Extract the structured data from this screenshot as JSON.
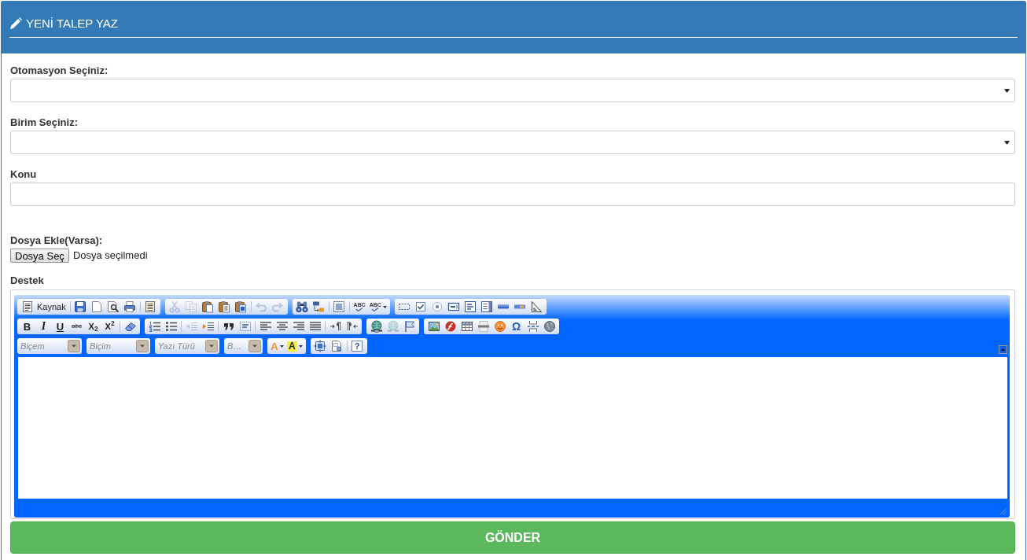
{
  "header": {
    "title": "YENİ TALEP YAZ"
  },
  "fields": [
    {
      "kind": "select",
      "label": "Otomasyon Seçiniz:"
    },
    {
      "kind": "select",
      "label": "Birim Seçiniz:"
    },
    {
      "kind": "text",
      "label": "Konu"
    }
  ],
  "attachment": {
    "label": "Dosya Ekle(Varsa):",
    "button": "Dosya Seç",
    "status": "Dosya seçilmedi"
  },
  "editor": {
    "label": "Destek",
    "toolbar": [
      {
        "groups": [
          {
            "kind": "buttons",
            "sections": [
              [
                {
                  "kind": "source",
                  "label": "Kaynak",
                  "disabled": false
                }
              ],
              [
                {
                  "kind": "save",
                  "disabled": false
                },
                {
                  "kind": "newpage",
                  "disabled": false
                },
                {
                  "kind": "preview",
                  "disabled": false
                },
                {
                  "kind": "print",
                  "disabled": false
                }
              ],
              [
                {
                  "kind": "templates",
                  "disabled": false
                }
              ]
            ]
          },
          {
            "kind": "buttons",
            "sections": [
              [
                {
                  "kind": "cut",
                  "disabled": true
                },
                {
                  "kind": "copy",
                  "disabled": true
                },
                {
                  "kind": "paste",
                  "disabled": false
                },
                {
                  "kind": "pastetext",
                  "disabled": false
                },
                {
                  "kind": "pasteword",
                  "disabled": false
                }
              ],
              [
                {
                  "kind": "undo",
                  "disabled": true
                },
                {
                  "kind": "redo",
                  "disabled": true
                }
              ]
            ]
          },
          {
            "kind": "buttons",
            "sections": [
              [
                {
                  "kind": "find",
                  "disabled": false
                },
                {
                  "kind": "replace",
                  "disabled": false
                }
              ],
              [
                {
                  "kind": "selectall",
                  "disabled": false
                }
              ],
              [
                {
                  "kind": "spellchecker",
                  "glyph": "ABC",
                  "disabled": false
                },
                {
                  "kind": "scayt",
                  "glyph": "ABC",
                  "disabled": false
                }
              ]
            ]
          },
          {
            "kind": "buttons",
            "sections": [
              [
                {
                  "kind": "form",
                  "disabled": false
                },
                {
                  "kind": "checkbox",
                  "disabled": false
                },
                {
                  "kind": "radio",
                  "disabled": false
                },
                {
                  "kind": "textfield",
                  "disabled": false
                },
                {
                  "kind": "textarea",
                  "disabled": false
                },
                {
                  "kind": "select",
                  "disabled": false
                },
                {
                  "kind": "button",
                  "disabled": false
                },
                {
                  "kind": "imagebutton",
                  "disabled": false
                },
                {
                  "kind": "hiddenfield",
                  "disabled": false
                }
              ]
            ]
          }
        ]
      },
      {
        "groups": [
          {
            "kind": "buttons",
            "sections": [
              [
                {
                  "kind": "bold",
                  "glyph": "B",
                  "disabled": false
                },
                {
                  "kind": "italic",
                  "glyph": "I",
                  "disabled": false
                },
                {
                  "kind": "underline",
                  "glyph": "U",
                  "disabled": false
                },
                {
                  "kind": "strike",
                  "glyph": "abc",
                  "disabled": false
                },
                {
                  "kind": "subscript",
                  "glyph": "X$_{2}$",
                  "disabled": false
                },
                {
                  "kind": "superscript",
                  "glyph": "X$^{2}$",
                  "disabled": false
                }
              ],
              [
                {
                  "kind": "removeformat",
                  "disabled": false
                }
              ]
            ]
          },
          {
            "kind": "buttons",
            "sections": [
              [
                {
                  "kind": "numberedlist",
                  "disabled": false
                },
                {
                  "kind": "bulletedlist",
                  "disabled": false
                }
              ],
              [
                {
                  "kind": "outdent",
                  "disabled": true
                },
                {
                  "kind": "indent",
                  "disabled": false
                }
              ],
              [
                {
                  "kind": "blockquote",
                  "disabled": false
                },
                {
                  "kind": "creatediv",
                  "disabled": false
                }
              ],
              [
                {
                  "kind": "justifyleft",
                  "disabled": false
                },
                {
                  "kind": "justifycenter",
                  "disabled": false
                },
                {
                  "kind": "justifyright",
                  "disabled": false
                },
                {
                  "kind": "justifyblock",
                  "disabled": false
                }
              ],
              [
                {
                  "kind": "bidiltr",
                  "disabled": false
                },
                {
                  "kind": "bidirtl",
                  "disabled": false
                }
              ]
            ]
          },
          {
            "kind": "buttons",
            "sections": [
              [
                {
                  "kind": "link",
                  "disabled": false
                },
                {
                  "kind": "unlink",
                  "disabled": true
                },
                {
                  "kind": "anchor",
                  "disabled": false
                }
              ]
            ]
          },
          {
            "kind": "buttons",
            "sections": [
              [
                {
                  "kind": "image",
                  "disabled": false
                },
                {
                  "kind": "flash",
                  "disabled": false
                },
                {
                  "kind": "table",
                  "disabled": false
                },
                {
                  "kind": "horizontalrule",
                  "disabled": false
                },
                {
                  "kind": "smiley",
                  "disabled": false
                },
                {
                  "kind": "specialchar",
                  "glyph": "Ω",
                  "disabled": false
                },
                {
                  "kind": "pagebreak",
                  "disabled": false
                },
                {
                  "kind": "iframe",
                  "disabled": false
                }
              ]
            ]
          }
        ]
      },
      {
        "groups": [
          {
            "kind": "combo",
            "label": "Biçem"
          },
          {
            "kind": "combo",
            "label": "Biçim"
          },
          {
            "kind": "combo",
            "label": "Yazı Türü"
          },
          {
            "kind": "combo",
            "label": "B…"
          },
          {
            "kind": "buttons",
            "sections": [
              [
                {
                  "kind": "textcolor",
                  "glyph": "A",
                  "disabled": false
                },
                {
                  "kind": "bgcolor",
                  "glyph": "A",
                  "disabled": false
                }
              ]
            ]
          },
          {
            "kind": "buttons",
            "sections": [
              [
                {
                  "kind": "maximize",
                  "disabled": false
                },
                {
                  "kind": "showblocks",
                  "disabled": false
                }
              ],
              [
                {
                  "kind": "about",
                  "glyph": "?",
                  "disabled": false
                }
              ]
            ]
          }
        ]
      }
    ]
  },
  "submit_button": {
    "label": "GÖNDER"
  }
}
